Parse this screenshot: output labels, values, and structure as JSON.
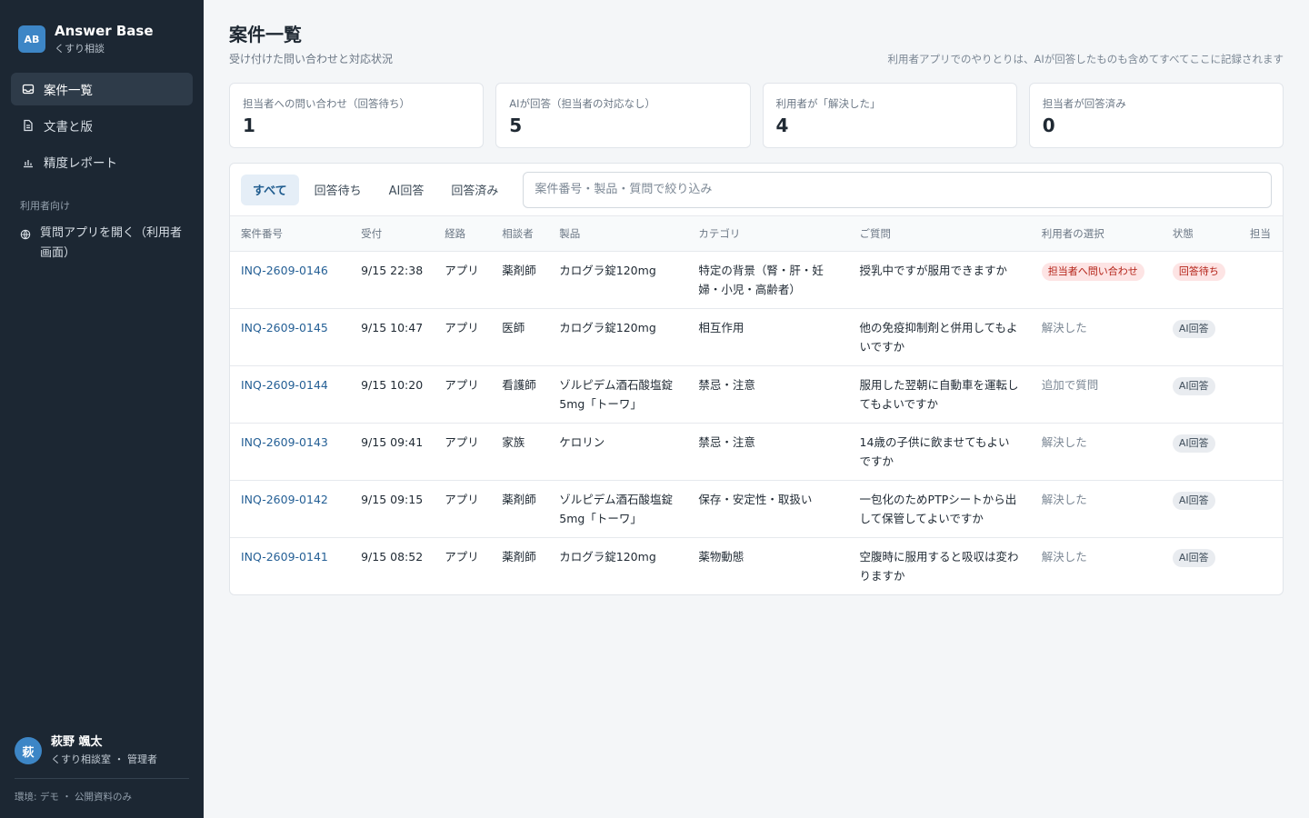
{
  "brand": {
    "logo": "AB",
    "title": "Answer Base",
    "subtitle": "くすり相談"
  },
  "nav": {
    "items": [
      {
        "label": "案件一覧",
        "icon": "inbox-icon"
      },
      {
        "label": "文書と版",
        "icon": "document-icon"
      },
      {
        "label": "精度レポート",
        "icon": "bar-chart-icon"
      }
    ],
    "section_label": "利用者向け",
    "external": {
      "label": "質問アプリを開く（利用者画面）",
      "icon": "globe-icon"
    }
  },
  "user": {
    "initial": "萩",
    "name": "萩野 颯太",
    "role": "くすり相談室 ・ 管理者"
  },
  "env": "環境: デモ ・ 公開資料のみ",
  "page": {
    "title": "案件一覧",
    "subtitle": "受け付けた問い合わせと対応状況",
    "note": "利用者アプリでのやりとりは、AIが回答したものも含めてすべてここに記録されます"
  },
  "stats": [
    {
      "label": "担当者への問い合わせ（回答待ち）",
      "value": "1"
    },
    {
      "label": "AIが回答（担当者の対応なし）",
      "value": "5"
    },
    {
      "label": "利用者が「解決した」",
      "value": "4"
    },
    {
      "label": "担当者が回答済み",
      "value": "0"
    }
  ],
  "tabs": [
    "すべて",
    "回答待ち",
    "AI回答",
    "回答済み"
  ],
  "search": {
    "placeholder": "案件番号・製品・質問で絞り込み",
    "value": ""
  },
  "table": {
    "headers": [
      "案件番号",
      "受付",
      "経路",
      "相談者",
      "製品",
      "カテゴリ",
      "ご質問",
      "利用者の選択",
      "状態",
      "担当"
    ],
    "rows": [
      {
        "id": "INQ-2609-0146",
        "received": "9/15 22:38",
        "channel": "アプリ",
        "requester": "薬剤師",
        "product": "カログラ錠120mg",
        "category": "特定の背景（腎・肝・妊婦・小児・高齢者）",
        "question": "授乳中ですが服用できますか",
        "choice": "担当者へ問い合わせ",
        "status": "回答待ち",
        "assignee": ""
      },
      {
        "id": "INQ-2609-0145",
        "received": "9/15 10:47",
        "channel": "アプリ",
        "requester": "医師",
        "product": "カログラ錠120mg",
        "category": "相互作用",
        "question": "他の免疫抑制剤と併用してもよいですか",
        "choice": "解決した",
        "status": "AI回答",
        "assignee": ""
      },
      {
        "id": "INQ-2609-0144",
        "received": "9/15 10:20",
        "channel": "アプリ",
        "requester": "看護師",
        "product": "ゾルピデム酒石酸塩錠5mg「トーワ」",
        "category": "禁忌・注意",
        "question": "服用した翌朝に自動車を運転してもよいですか",
        "choice": "追加で質問",
        "status": "AI回答",
        "assignee": ""
      },
      {
        "id": "INQ-2609-0143",
        "received": "9/15 09:41",
        "channel": "アプリ",
        "requester": "家族",
        "product": "ケロリン",
        "category": "禁忌・注意",
        "question": "14歳の子供に飲ませてもよいですか",
        "choice": "解決した",
        "status": "AI回答",
        "assignee": ""
      },
      {
        "id": "INQ-2609-0142",
        "received": "9/15 09:15",
        "channel": "アプリ",
        "requester": "薬剤師",
        "product": "ゾルピデム酒石酸塩錠5mg「トーワ」",
        "category": "保存・安定性・取扱い",
        "question": "一包化のためPTPシートから出して保管してよいですか",
        "choice": "解決した",
        "status": "AI回答",
        "assignee": ""
      },
      {
        "id": "INQ-2609-0141",
        "received": "9/15 08:52",
        "channel": "アプリ",
        "requester": "薬剤師",
        "product": "カログラ錠120mg",
        "category": "薬物動態",
        "question": "空腹時に服用すると吸収は変わりますか",
        "choice": "解決した",
        "status": "AI回答",
        "assignee": ""
      }
    ]
  }
}
